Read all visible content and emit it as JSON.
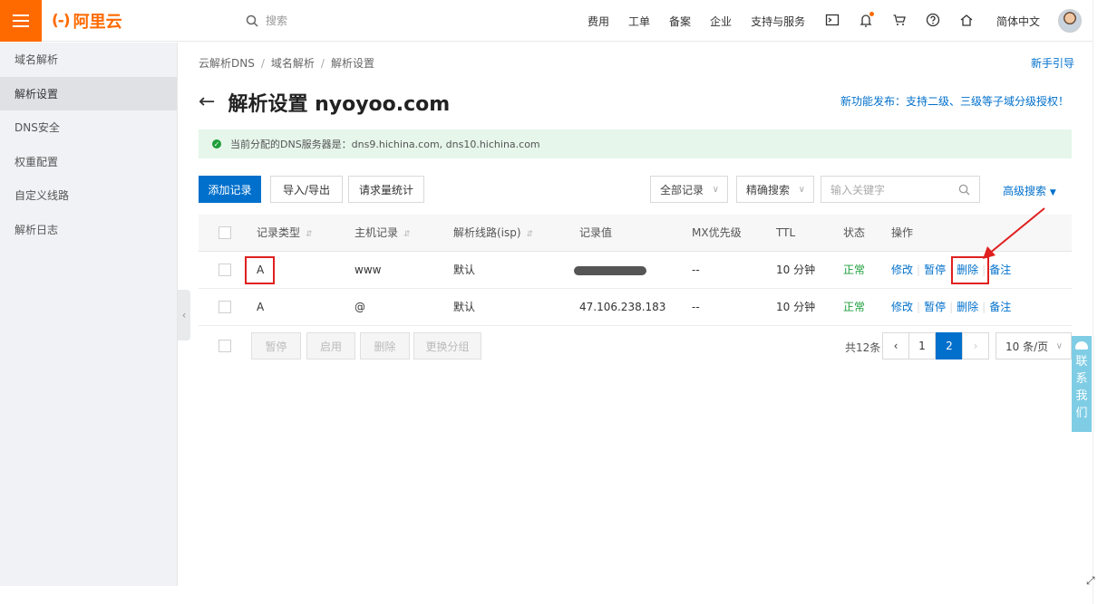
{
  "topbar": {
    "logo_text": "阿里云",
    "logo_mark": "(-)",
    "search_placeholder": "搜索",
    "nav": [
      "费用",
      "工单",
      "备案",
      "企业",
      "支持与服务"
    ],
    "language": "简体中文"
  },
  "sidebar": {
    "items": [
      {
        "label": "域名解析",
        "active": false
      },
      {
        "label": "解析设置",
        "active": true
      },
      {
        "label": "DNS安全",
        "active": false
      },
      {
        "label": "权重配置",
        "active": false
      },
      {
        "label": "自定义线路",
        "active": false
      },
      {
        "label": "解析日志",
        "active": false
      }
    ]
  },
  "breadcrumb": [
    "云解析DNS",
    "域名解析",
    "解析设置"
  ],
  "guide_link": "新手引导",
  "page_title": "解析设置 nyoyoo.com",
  "feature_link": "新功能发布：支持二级、三级等子域分级授权！",
  "dns_banner": "当前分配的DNS服务器是：dns9.hichina.com, dns10.hichina.com",
  "toolbar": {
    "add_record": "添加记录",
    "import_export": "导入/导出",
    "request_stats": "请求量统计",
    "record_filter": "全部记录",
    "search_mode": "精确搜索",
    "keyword_placeholder": "输入关键字",
    "advanced_search": "高级搜索"
  },
  "table": {
    "headers": [
      "记录类型",
      "主机记录",
      "解析线路(isp)",
      "记录值",
      "MX优先级",
      "TTL",
      "状态",
      "操作"
    ],
    "rows": [
      {
        "type": "A",
        "host": "www",
        "line": "默认",
        "value": "",
        "mx": "--",
        "ttl": "10 分钟",
        "status": "正常"
      },
      {
        "type": "A",
        "host": "@",
        "line": "默认",
        "value": "47.106.238.183",
        "mx": "--",
        "ttl": "10 分钟",
        "status": "正常"
      }
    ],
    "actions": [
      "修改",
      "暂停",
      "删除",
      "备注"
    ]
  },
  "footer": {
    "bulk_buttons": [
      "暂停",
      "启用",
      "删除",
      "更换分组"
    ],
    "total": "共12条",
    "pages": [
      "1",
      "2"
    ],
    "current_page": "2",
    "page_size": "10 条/页"
  },
  "contact": [
    "联",
    "系",
    "我",
    "们"
  ],
  "colors": {
    "brand": "#ff6a00",
    "primary": "#0070cc",
    "success": "#1e9e3b",
    "annotation": "#e02020"
  }
}
